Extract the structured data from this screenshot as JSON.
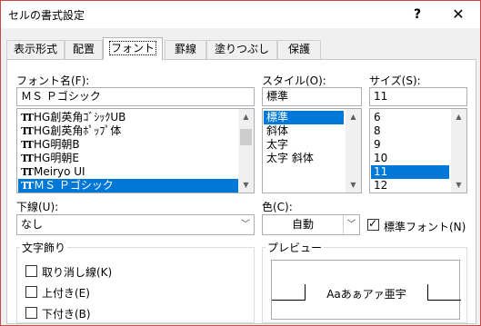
{
  "window": {
    "title": "セルの書式設定",
    "help": "?",
    "close": "✕"
  },
  "tabs": [
    {
      "label": "表示形式"
    },
    {
      "label": "配置"
    },
    {
      "label": "フォント"
    },
    {
      "label": "罫線"
    },
    {
      "label": "塗りつぶし"
    },
    {
      "label": "保護"
    }
  ],
  "font": {
    "label": "フォント名(F):",
    "value": "ＭＳ Ｐゴシック",
    "items": [
      "HG創英角ｺﾞｼｯｸUB",
      "HG創英角ﾎﾟｯﾌﾟ体",
      "HG明朝B",
      "HG明朝E",
      "Meiryo UI",
      "ＭＳ Ｐゴシック"
    ],
    "selected_index": 5
  },
  "style": {
    "label": "スタイル(O):",
    "value": "標準",
    "items": [
      "標準",
      "斜体",
      "太字",
      "太字 斜体"
    ],
    "selected_index": 0
  },
  "size": {
    "label": "サイズ(S):",
    "value": "11",
    "items": [
      "6",
      "8",
      "9",
      "10",
      "11",
      "12"
    ],
    "selected_index": 4
  },
  "underline": {
    "label": "下線(U):",
    "value": "なし"
  },
  "color": {
    "label": "色(C):",
    "value": "自動",
    "normal_font_label": "標準フォント(N)",
    "normal_font_checked": true
  },
  "effects": {
    "title": "文字飾り",
    "strikethrough": "取り消し線(K)",
    "superscript": "上付き(E)",
    "subscript": "下付き(B)"
  },
  "preview": {
    "title": "プレビュー",
    "sample": "Aaあぁアァ亜宇"
  }
}
